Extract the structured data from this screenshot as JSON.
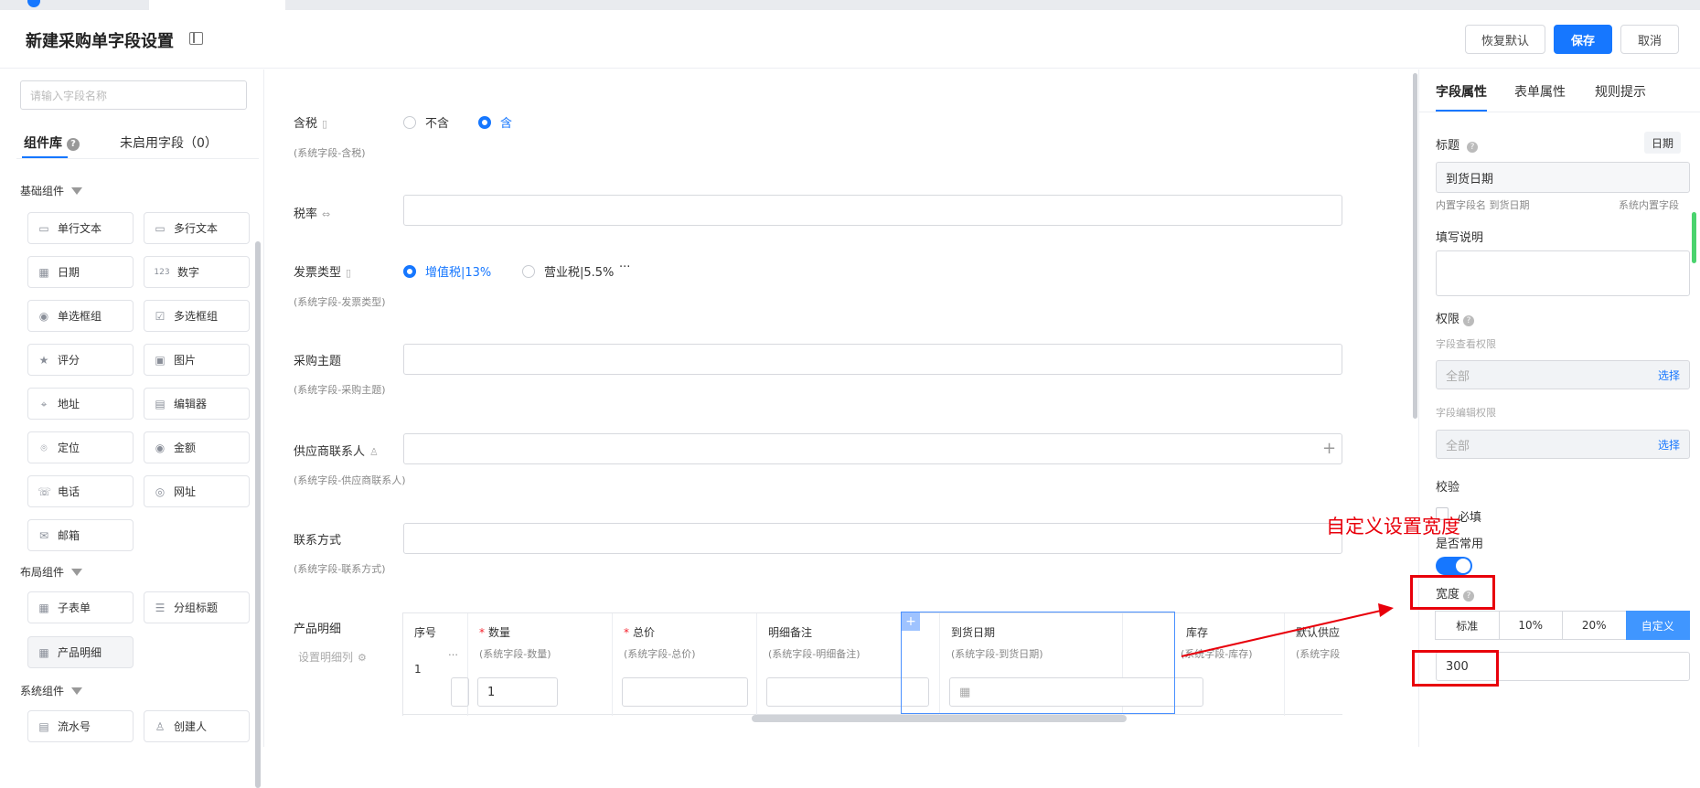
{
  "header": {
    "title": "新建采购单字段设置",
    "restore_label": "恢复默认",
    "save_label": "保存",
    "cancel_label": "取消"
  },
  "left": {
    "search_placeholder": "请输入字段名称",
    "tabs": [
      "组件库",
      "未启用字段（0）"
    ],
    "help_glyph": "?",
    "groups": {
      "basic": "基础组件",
      "layout": "布局组件",
      "system": "系统组件"
    },
    "basic_items": [
      "单行文本",
      "多行文本",
      "日期",
      "数字",
      "单选框组",
      "多选框组",
      "评分",
      "图片",
      "地址",
      "编辑器",
      "定位",
      "金额",
      "电话",
      "网址",
      "邮箱"
    ],
    "layout_items": [
      "子表单",
      "分组标题",
      "产品明细"
    ],
    "system_items": [
      "流水号",
      "创建人"
    ],
    "icons": [
      "text-line-icon",
      "text-area-icon",
      "calendar-icon",
      "number-icon",
      "radio-icon",
      "checkbox-icon",
      "star-icon",
      "image-icon",
      "location-pin-icon",
      "editor-icon",
      "locate-icon",
      "money-icon",
      "phone-icon",
      "link-icon",
      "mail-icon"
    ]
  },
  "form": {
    "tax_label": "含税",
    "tax_sub": "(系统字段-含税)",
    "tax_options": [
      "不含",
      "含"
    ],
    "rate_label": "税率",
    "invoice_label": "发票类型",
    "invoice_sub": "(系统字段-发票类型)",
    "invoice_options": [
      "增值税|13%",
      "营业税|5.5%"
    ],
    "invoice_more": "···",
    "subject_label": "采购主题",
    "subject_sub": "(系统字段-采购主题)",
    "contact_label": "供应商联系人",
    "contact_sub": "(系统字段-供应商联系人)",
    "contact_plus": "+",
    "method_label": "联系方式",
    "method_sub": "(系统字段-联系方式)",
    "detail_label": "产品明细",
    "detail_setting": "设置明细列",
    "detail_table": {
      "seq_header": "序号",
      "seq_value": "1",
      "seq_sub": "…",
      "columns": [
        {
          "name": "数量",
          "required": true,
          "sub": "(系统字段-数量)",
          "value": "1"
        },
        {
          "name": "总价",
          "required": true,
          "sub": "(系统字段-总价)",
          "value": ""
        },
        {
          "name": "明细备注",
          "required": false,
          "sub": "(系统字段-明细备注)",
          "value": ""
        },
        {
          "name": "到货日期",
          "required": false,
          "sub": "(系统字段-到货日期)",
          "value": ""
        },
        {
          "name": "库存",
          "required": false,
          "sub": "(系统字段-库存)",
          "value": ""
        },
        {
          "name": "默认供应",
          "required": false,
          "sub": "(系统字段",
          "value": ""
        }
      ],
      "star": "*"
    }
  },
  "right": {
    "tabs": [
      "字段属性",
      "表单属性",
      "规则提示"
    ],
    "title_label": "标题",
    "help_glyph": "?",
    "type_badge": "日期",
    "title_value": "到货日期",
    "builtin_name": "内置字段名 到货日期",
    "builtin_tag": "系统内置字段",
    "desc_label": "填写说明",
    "perm_label": "权限",
    "view_perm_label": "字段查看权限",
    "view_perm_value": "全部",
    "edit_perm_label": "字段编辑权限",
    "edit_perm_value": "全部",
    "choose_label": "选择",
    "verify_label": "校验",
    "required_label": "必填",
    "common_label": "是否常用",
    "common_on": true,
    "width_label": "宽度",
    "width_options": [
      "标准",
      "10%",
      "20%",
      "自定义"
    ],
    "width_selected": "自定义",
    "width_value": "300"
  },
  "annotation": {
    "text": "自定义设置宽度",
    "color": "#e8000b"
  },
  "colors": {
    "accent": "#1677ff",
    "annotation_red": "#e8000b",
    "toggle_on": "#1677ff"
  }
}
